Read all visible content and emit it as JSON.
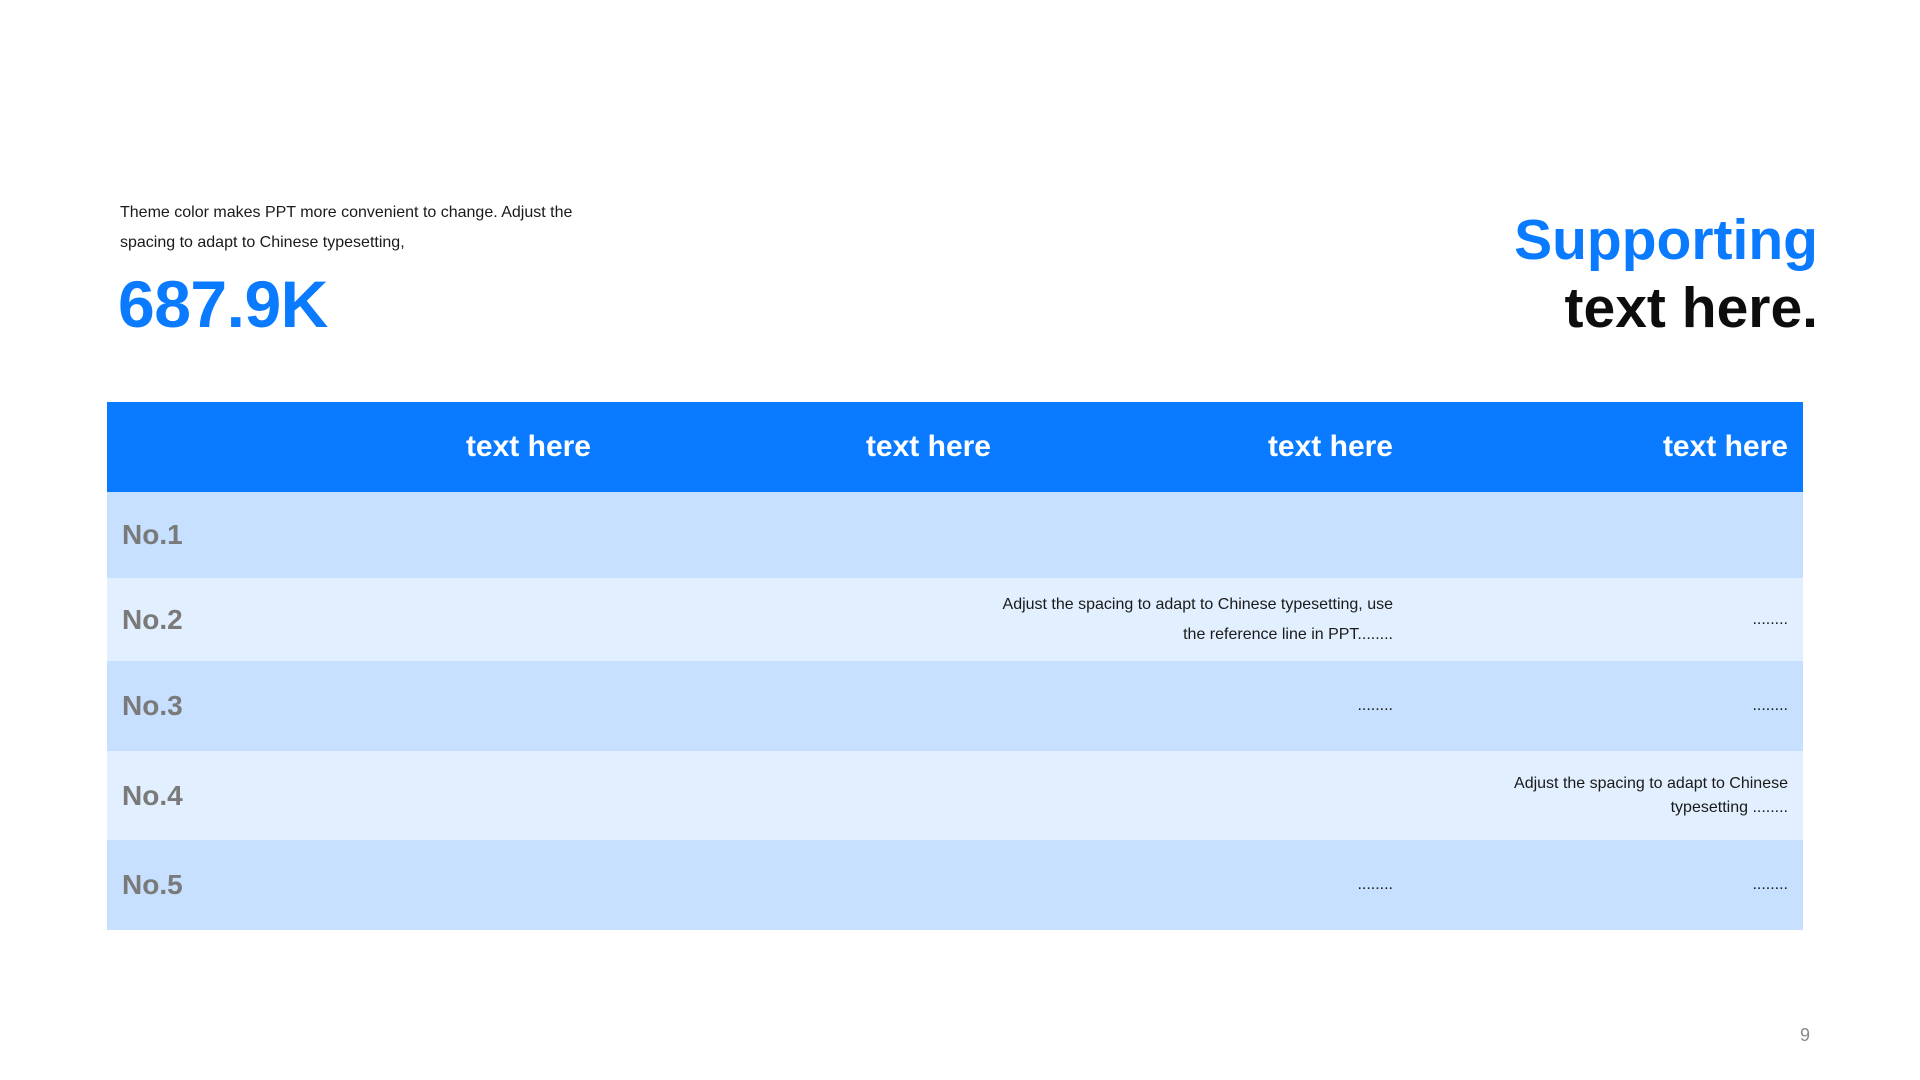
{
  "intro": {
    "text": "Theme color makes PPT more convenient to change. Adjust the spacing to adapt to Chinese typesetting,"
  },
  "stat": {
    "value": "687.9K"
  },
  "supporting": {
    "line1": "Supporting",
    "line2": "text here."
  },
  "table": {
    "headers": [
      "",
      "text here",
      "text here",
      "text here",
      "text here"
    ],
    "rows": [
      {
        "label": "No.1",
        "cells": [
          "",
          "",
          "",
          ""
        ]
      },
      {
        "label": "No.2",
        "cells": [
          "",
          "",
          "Adjust the spacing to adapt to Chinese typesetting, use the reference line in PPT........",
          "........"
        ]
      },
      {
        "label": "No.3",
        "cells": [
          "",
          "",
          "........",
          "........"
        ]
      },
      {
        "label": "No.4",
        "cells": [
          "",
          "",
          "",
          "Adjust the spacing to adapt to Chinese typesetting ........"
        ]
      },
      {
        "label": "No.5",
        "cells": [
          "",
          "",
          "........",
          "........"
        ]
      }
    ]
  },
  "page_number": "9",
  "colors": {
    "accent": "#0a7bff",
    "header_bg": "#0a7bff",
    "row_dark": "#c7e0ff",
    "row_light": "#e1efff",
    "row_label": "#7a7a7a"
  }
}
